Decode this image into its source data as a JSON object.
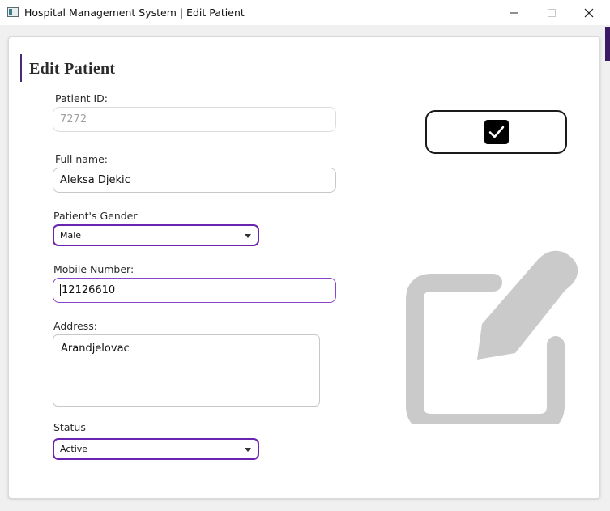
{
  "window": {
    "title": "Hospital Management System | Edit Patient",
    "icon": "app-window-icon",
    "controls": [
      "minimize-icon",
      "maximize-icon",
      "close-icon"
    ]
  },
  "form": {
    "heading": "Edit Patient",
    "patient_id": {
      "label": "Patient ID:",
      "value": "7272"
    },
    "full_name": {
      "label": "Full name:",
      "value": "Aleksa Djekic"
    },
    "gender": {
      "label": "Patient's Gender",
      "selected": "Male"
    },
    "mobile": {
      "label": "Mobile Number:",
      "value": "12126610"
    },
    "address": {
      "label": "Address:",
      "value": "Arandjelovac"
    },
    "status": {
      "label": "Status",
      "selected": "Active"
    }
  },
  "actions": {
    "save_icon": "checkbox-check-icon"
  },
  "illustration": {
    "icon": "edit-pencil-icon"
  },
  "colors": {
    "accent": "#6a24b0",
    "heading_bar": "#4b2a7a",
    "illustration": "#cacaca"
  }
}
